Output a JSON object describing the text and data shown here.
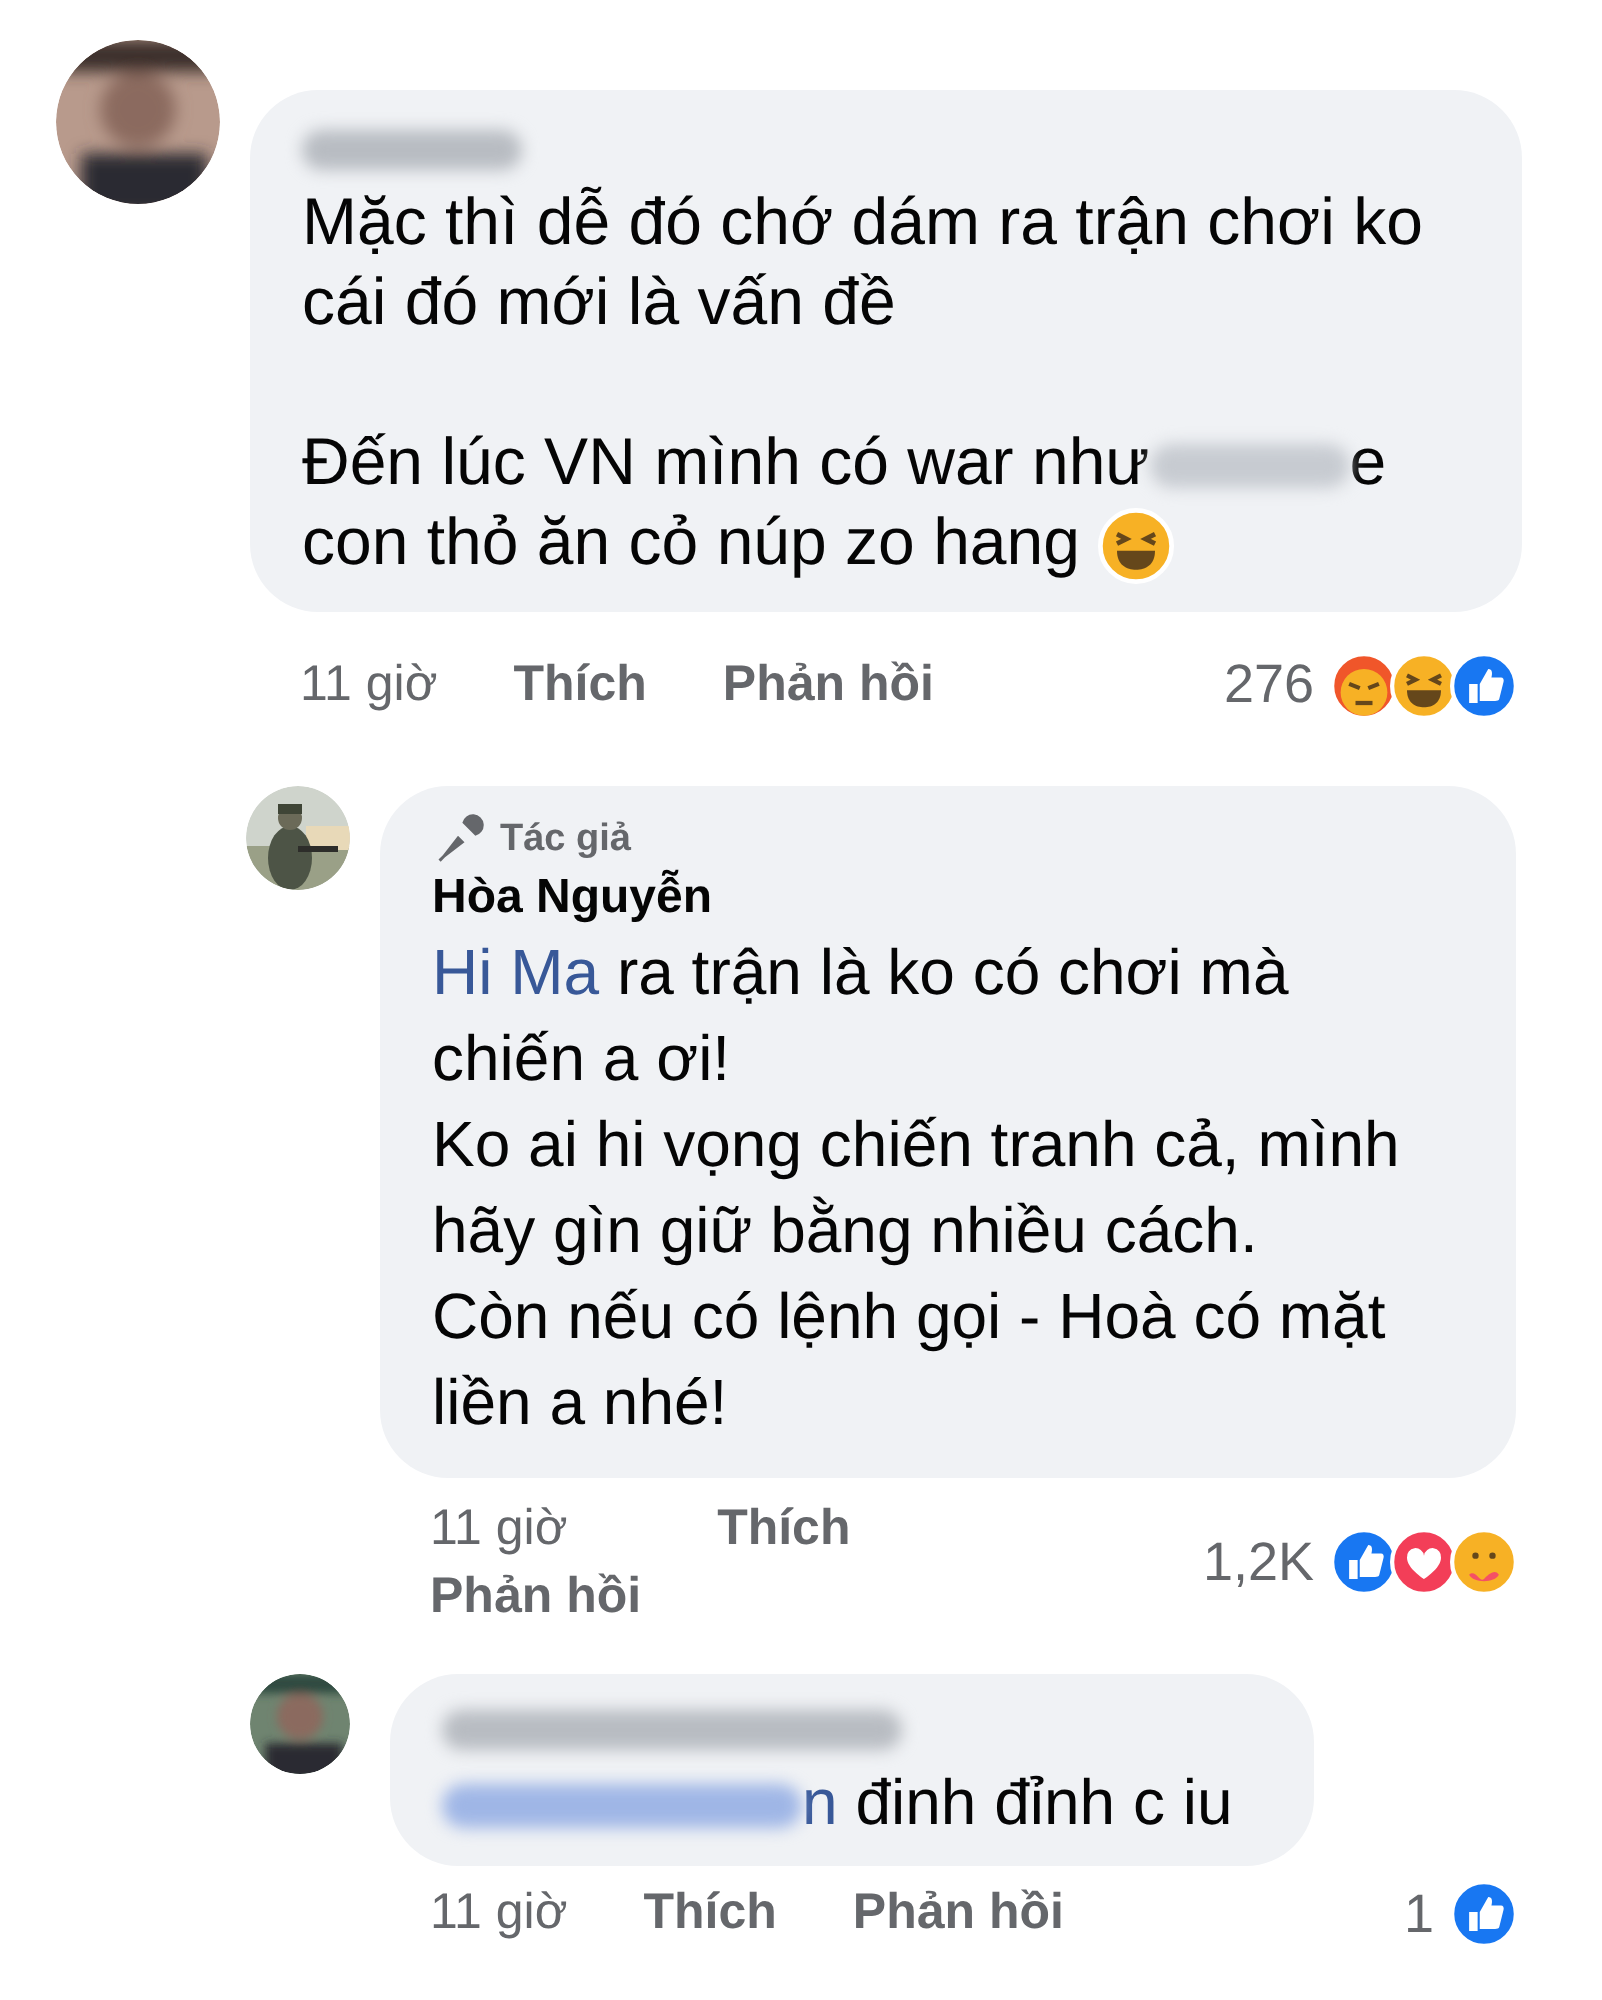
{
  "comments": [
    {
      "name_blurred": true,
      "blocks": [
        [
          {
            "segments": [
              {
                "kind": "text",
                "text": "Mặc thì dễ đó chớ dám ra trận chơi ko cái đó mới là vấn đề"
              }
            ]
          }
        ],
        [
          {
            "segments": [
              {
                "kind": "text",
                "text": "Đến lúc VN mình có war như"
              },
              {
                "kind": "blur"
              },
              {
                "kind": "text",
                "text": "e"
              }
            ]
          },
          {
            "segments": [
              {
                "kind": "text",
                "text": "con thỏ ăn cỏ núp zo hang "
              },
              {
                "kind": "emoji"
              }
            ]
          }
        ]
      ],
      "time": "11 giờ",
      "like": "Thích",
      "reply": "Phản hồi",
      "count": "276",
      "reactions": [
        {
          "kind": "angry"
        },
        {
          "kind": "haha"
        },
        {
          "kind": "like"
        }
      ]
    },
    {
      "name_blurred": false,
      "author_badge": "Tác giả",
      "name": "Hòa Nguyễn",
      "blocks": [
        [
          {
            "segments": [
              {
                "kind": "mention",
                "text": "Hi Ma"
              },
              {
                "kind": "text",
                "text": " ra trận là ko có chơi mà chiến a ơi!"
              }
            ]
          },
          {
            "segments": [
              {
                "kind": "text",
                "text": "Ko ai hi vọng chiến tranh cả, mình hãy gìn giữ bằng nhiều cách."
              }
            ]
          },
          {
            "segments": [
              {
                "kind": "text",
                "text": "Còn nếu có lệnh gọi - Hoà có mặt liền a nhé!"
              }
            ]
          }
        ]
      ],
      "time": "11 giờ",
      "like": "Thích",
      "reply": "Phản hồi",
      "count": "1,2K",
      "reactions": [
        {
          "kind": "like"
        },
        {
          "kind": "love"
        },
        {
          "kind": "care"
        }
      ]
    },
    {
      "name_blurred": true,
      "blocks": [
        [
          {
            "segments": [
              {
                "kind": "blur"
              },
              {
                "kind": "mention",
                "text": "n"
              },
              {
                "kind": "text",
                "text": " đinh đỉnh c iu"
              }
            ]
          }
        ]
      ],
      "time": "11 giờ",
      "like": "Thích",
      "reply": "Phản hồi",
      "count": "1",
      "reactions": [
        {
          "kind": "like"
        }
      ]
    }
  ]
}
